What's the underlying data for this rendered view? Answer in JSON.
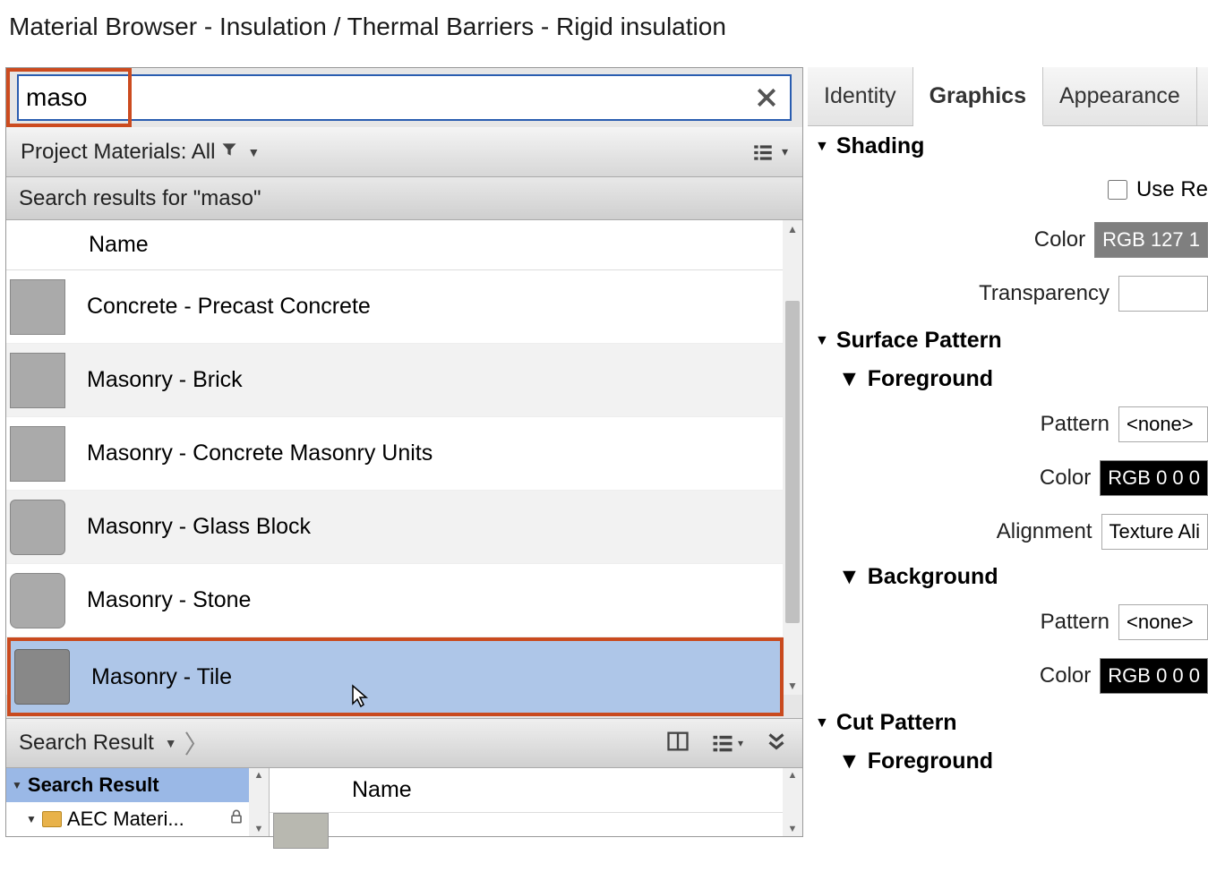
{
  "window_title": "Material Browser - Insulation / Thermal Barriers - Rigid insulation",
  "search": {
    "value": "maso"
  },
  "filter_label": "Project Materials: All",
  "results_label": "Search results for \"maso\"",
  "list": {
    "header": "Name",
    "items": [
      {
        "name": "Concrete - Precast Concrete"
      },
      {
        "name": "Masonry - Brick"
      },
      {
        "name": "Masonry - Concrete Masonry Units"
      },
      {
        "name": "Masonry - Glass Block"
      },
      {
        "name": "Masonry - Stone"
      },
      {
        "name": "Masonry - Tile"
      }
    ]
  },
  "breadcrumb": {
    "label": "Search Result"
  },
  "tree": {
    "root": "Search Result",
    "child": "AEC Materi..."
  },
  "library_header": "Name",
  "tabs": {
    "identity": "Identity",
    "graphics": "Graphics",
    "appearance": "Appearance"
  },
  "sections": {
    "shading": "Shading",
    "use_render": "Use Re",
    "color_lbl": "Color",
    "shading_color": "RGB 127 1",
    "transparency_lbl": "Transparency",
    "surface_pattern": "Surface Pattern",
    "foreground": "Foreground",
    "pattern_lbl": "Pattern",
    "pattern_none": "<none>",
    "fg_color": "RGB 0 0 0",
    "alignment_lbl": "Alignment",
    "alignment_val": "Texture Ali",
    "background": "Background",
    "bg_pattern_none": "<none>",
    "bg_color": "RGB 0 0 0",
    "cut_pattern": "Cut Pattern",
    "cut_foreground": "Foreground"
  }
}
